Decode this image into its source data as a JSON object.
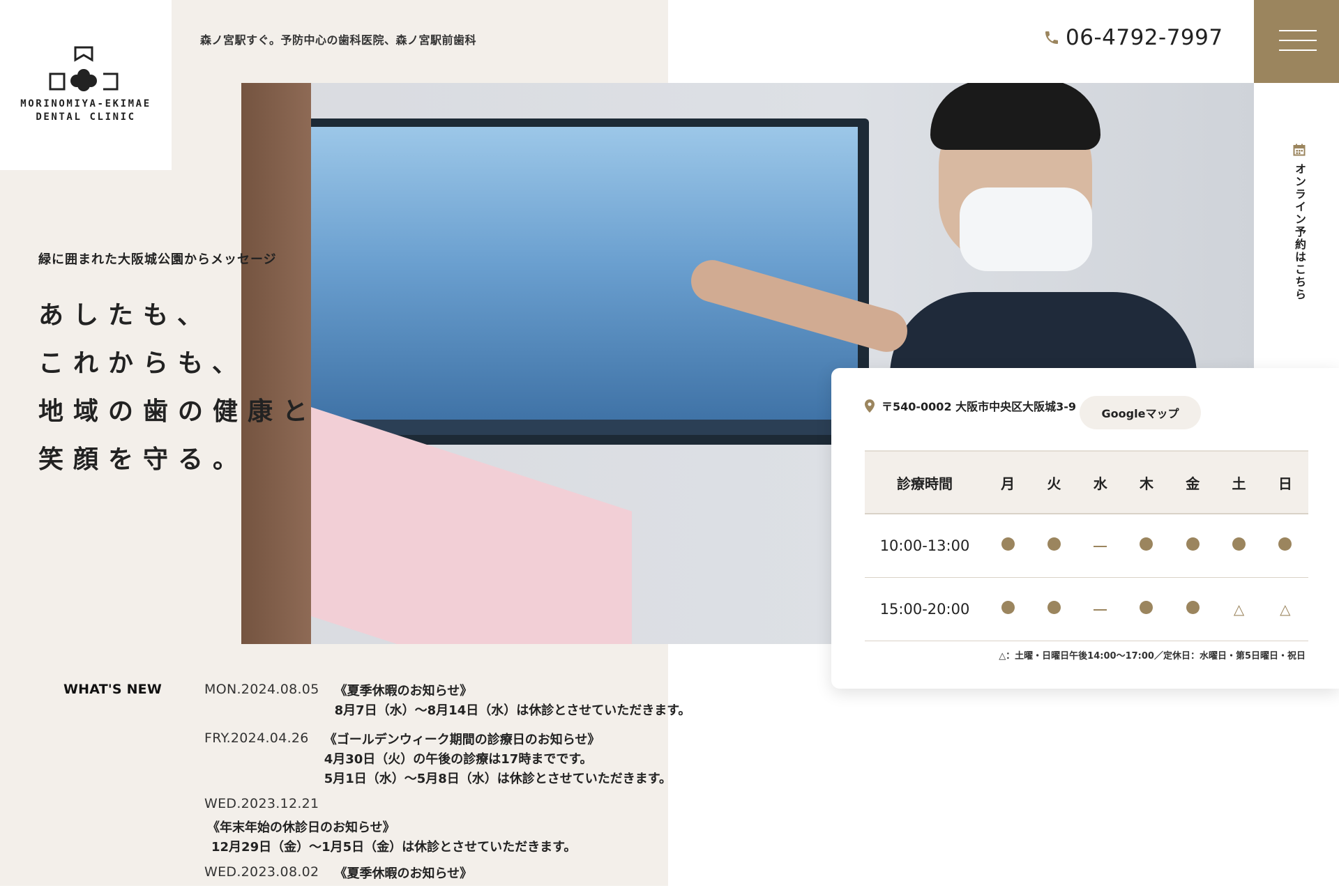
{
  "header": {
    "logo_line1": "MORINOMIYA-EKIMAE",
    "logo_line2": "DENTAL CLINIC",
    "tagline": "森ノ宮駅すぐ。予防中心の歯科医院、森ノ宮駅前歯科",
    "phone": "06-4792-7997",
    "phone_icon": "phone-icon",
    "menu_icon": "hamburger-menu-icon"
  },
  "hero": {
    "catch": "緑に囲まれた大阪城公園からメッセージ",
    "heading_lines": [
      "あしたも、",
      "これからも、",
      "地域の歯の健康と",
      "笑顔を守る。"
    ]
  },
  "side_reserve": {
    "label": "オンライン予約はこちら",
    "icon": "calendar-icon"
  },
  "info": {
    "address": "〒540-0002 大阪市中央区大阪城3-9",
    "map_button": "Googleマップ",
    "hours": {
      "header": [
        "診療時間",
        "月",
        "火",
        "水",
        "木",
        "金",
        "土",
        "日"
      ],
      "rows": [
        {
          "time": "10:00-13:00",
          "marks": [
            "●",
            "●",
            "−",
            "●",
            "●",
            "●",
            "●"
          ]
        },
        {
          "time": "15:00-20:00",
          "marks": [
            "●",
            "●",
            "−",
            "●",
            "●",
            "△",
            "△"
          ]
        }
      ]
    },
    "note": "△：土曜・日曜日午後14:00〜17:00／定休日：水曜日・第5日曜日・祝日"
  },
  "news": {
    "label": "WHAT'S NEW",
    "items": [
      {
        "date": "MON.2024.08.05",
        "title": "《夏季休暇のお知らせ》",
        "body": [
          "8月7日（水）〜8月14日（水）は休診とさせていただきます。"
        ]
      },
      {
        "date": "FRY.2024.04.26",
        "title": "《ゴールデンウィーク期間の診療日のお知らせ》",
        "body": [
          "4月30日（火）の午後の診療は17時までです。",
          "5月1日（水）〜5月8日（水）は休診とさせていただきます。"
        ]
      },
      {
        "date": "WED.2023.12.21",
        "title": "《年末年始の休診日のお知らせ》",
        "body": [
          "12月29日（金）〜1月5日（金）は休診とさせていただきます。"
        ]
      },
      {
        "date": "WED.2023.08.02",
        "title": "《夏季休暇のお知らせ》",
        "body": []
      }
    ]
  },
  "colors": {
    "accent": "#9b855e",
    "beige": "#f3efea"
  }
}
